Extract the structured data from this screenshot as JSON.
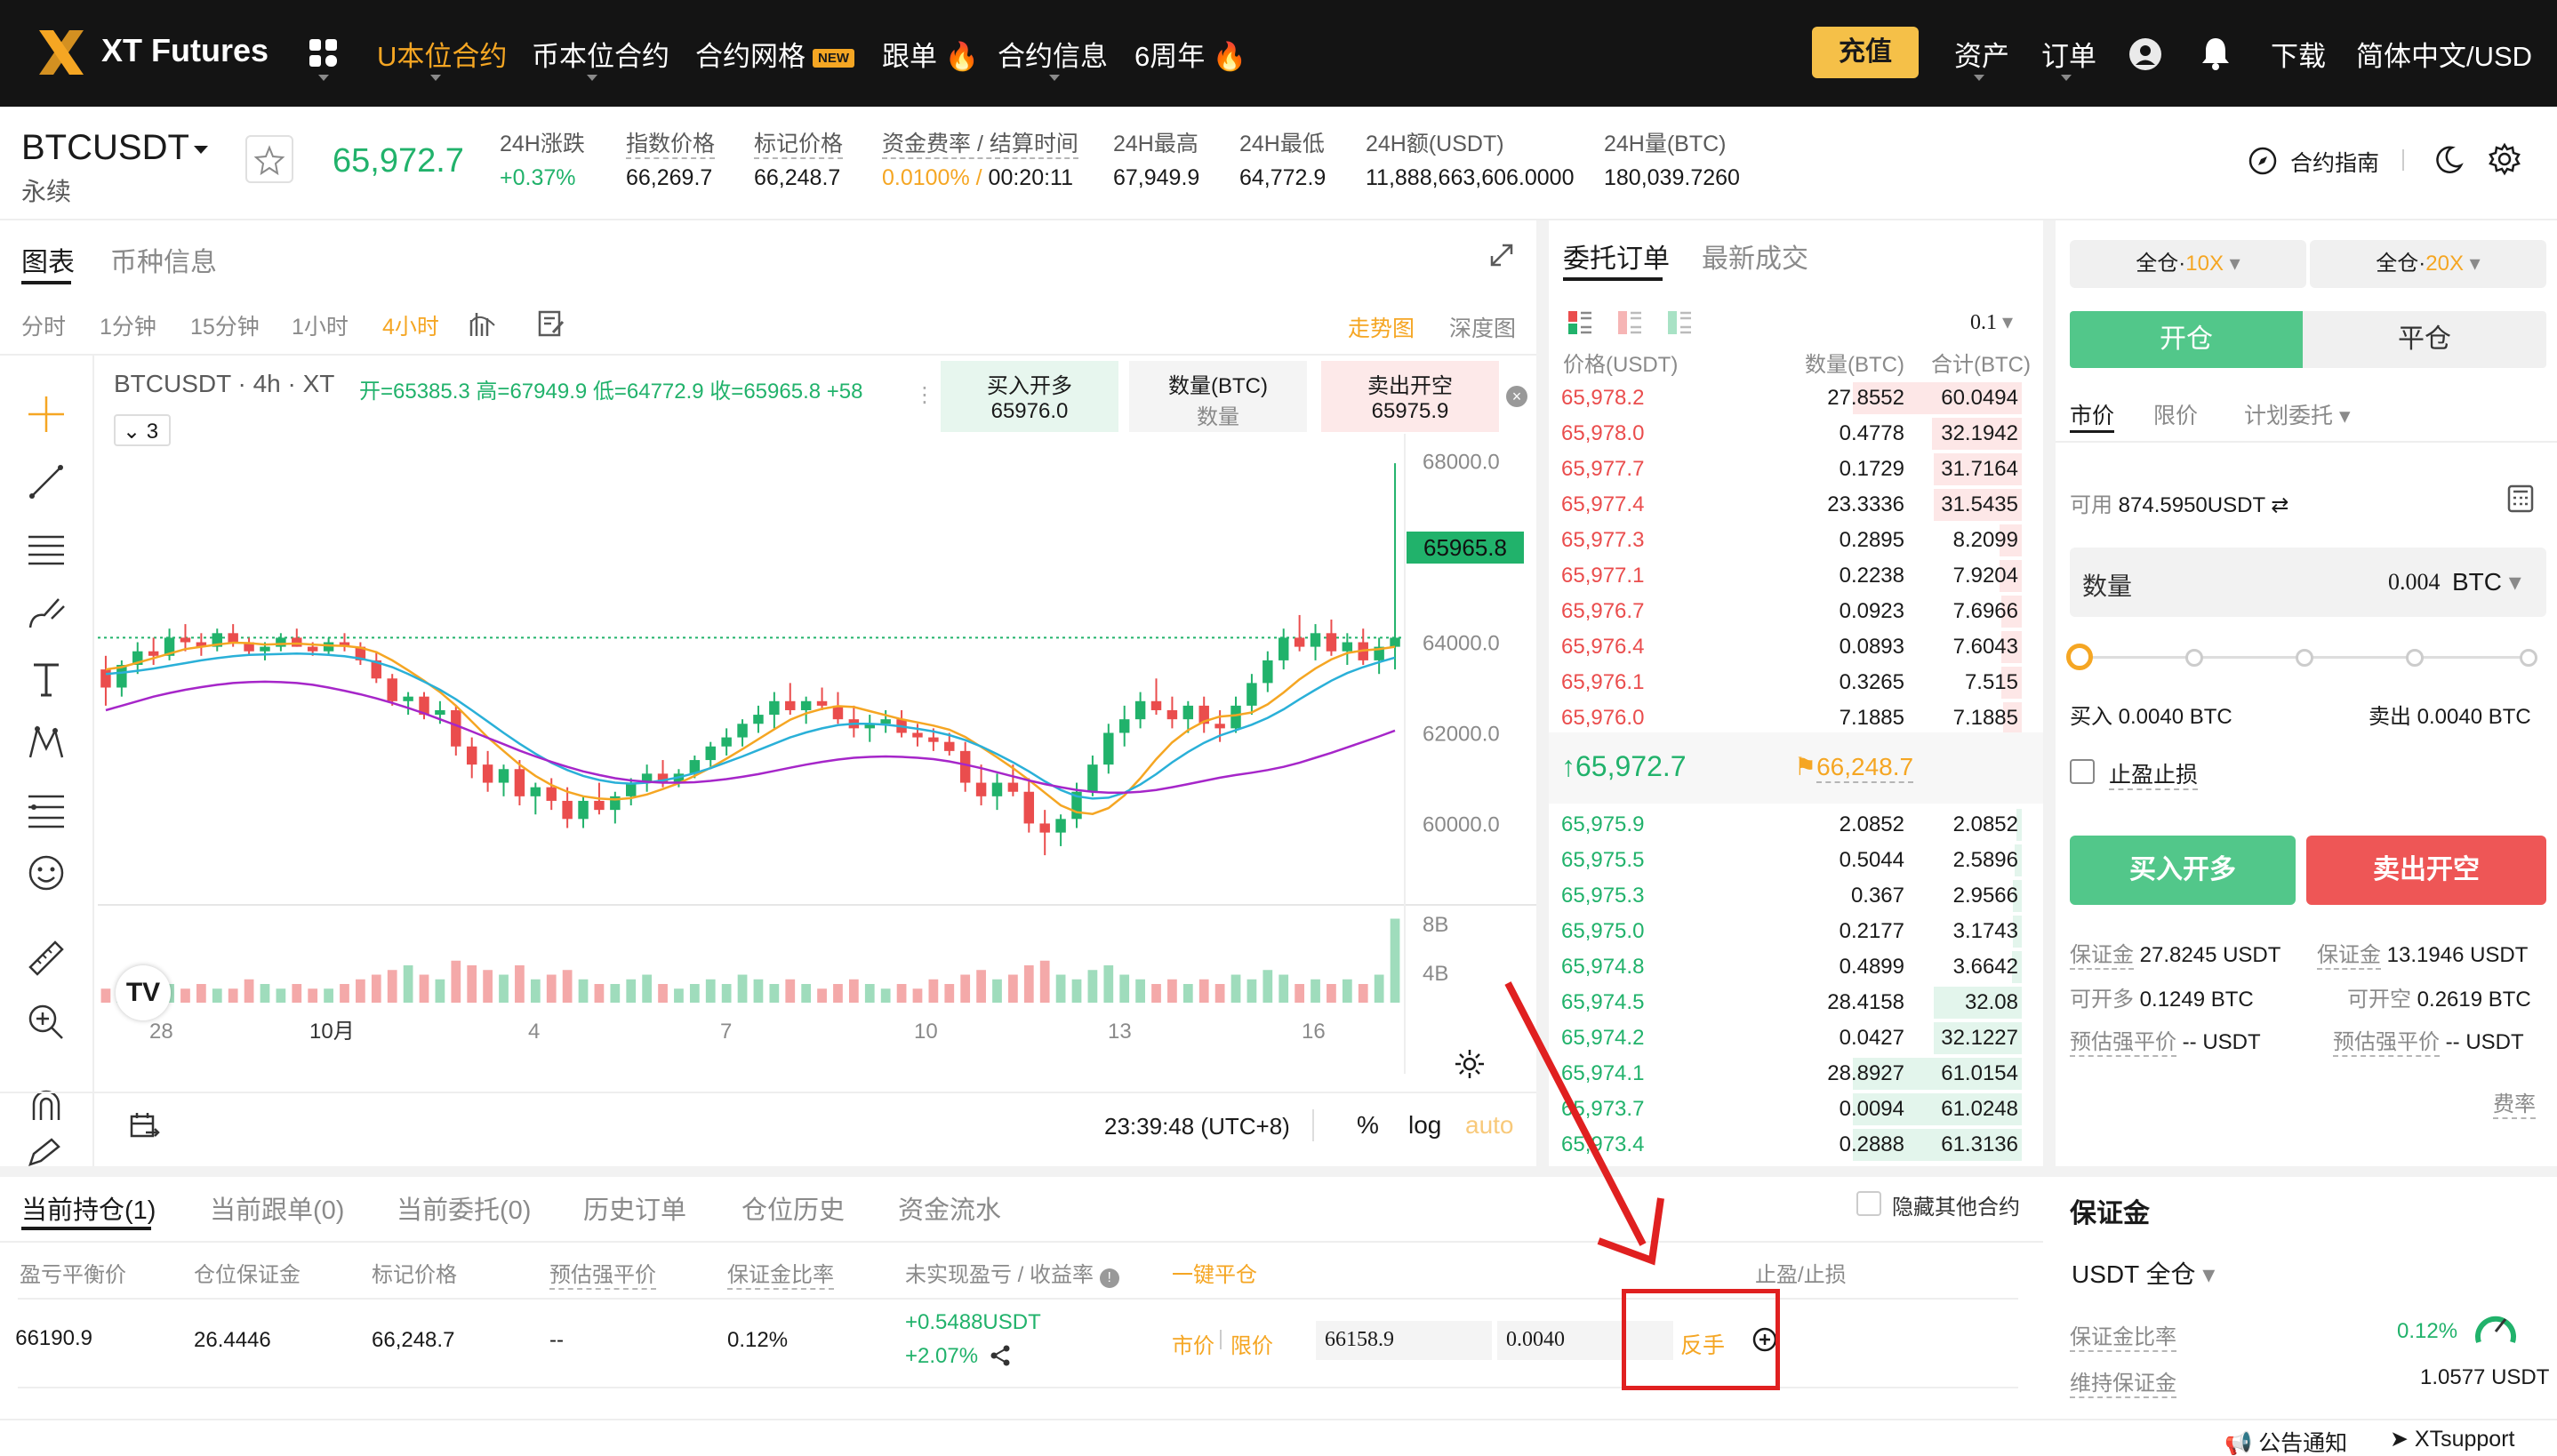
{
  "nav": {
    "logo_text": "XT Futures",
    "items": [
      "U本位合约",
      "币本位合约",
      "合约网格",
      "跟单",
      "合约信息",
      "6周年"
    ],
    "new_badge": "NEW",
    "deposit": "充值",
    "assets": "资产",
    "orders": "订单",
    "download": "下载",
    "locale": "简体中文/USD"
  },
  "ticker": {
    "symbol": "BTCUSDT",
    "subtitle": "永续",
    "last_price": "65,972.7",
    "change_label": "24H涨跌",
    "change_value": "+0.37%",
    "index_label": "指数价格",
    "index_value": "66,269.7",
    "mark_label": "标记价格",
    "mark_value": "66,248.7",
    "funding_label": "资金费率 / 结算时间",
    "funding_rate": "0.0100%",
    "funding_sep": " / ",
    "funding_time": "00:20:11",
    "high_label": "24H最高",
    "high_value": "67,949.9",
    "low_label": "24H最低",
    "low_value": "64,772.9",
    "vol_usdt_label": "24H额(USDT)",
    "vol_usdt_value": "11,888,663,606.0000",
    "vol_btc_label": "24H量(BTC)",
    "vol_btc_value": "180,039.7260",
    "guide": "合约指南"
  },
  "chart_panel": {
    "tabs": [
      "图表",
      "币种信息"
    ],
    "intervals": [
      "分时",
      "1分钟",
      "15分钟",
      "1小时",
      "4小时"
    ],
    "view_trend": "走势图",
    "view_depth": "深度图",
    "legend_symbol": "BTCUSDT · 4h · XT",
    "ohlc": "开=65385.3  高=67949.9  低=64772.9  收=65965.8  +58",
    "indicator_count": "3",
    "buy_label": "买入开多",
    "buy_price": "65976.0",
    "qty_label": "数量(BTC)",
    "qty_sub": "数量",
    "sell_label": "卖出开空",
    "sell_price": "65975.9",
    "last_price_tag": "65965.8",
    "clock": "23:39:48 (UTC+8)",
    "pct": "%",
    "log": "log",
    "auto": "auto"
  },
  "chart_data": {
    "type": "candlestick",
    "x_ticks": [
      "28",
      "10月",
      "4",
      "7",
      "10",
      "13",
      "16"
    ],
    "y_ticks": [
      68000.0,
      64000.0,
      62000.0,
      60000.0
    ],
    "ylim": [
      58400,
      68600
    ],
    "volume_ticks": [
      "8B",
      "4B"
    ],
    "series": [
      {
        "name": "candles",
        "ohlc": [
          [
            63400,
            63700,
            62600,
            63000
          ],
          [
            63000,
            63600,
            62800,
            63500
          ],
          [
            63500,
            64000,
            63300,
            63800
          ],
          [
            63800,
            64100,
            63500,
            63700
          ],
          [
            63700,
            64300,
            63600,
            64100
          ],
          [
            64100,
            64400,
            63800,
            64000
          ],
          [
            64000,
            64200,
            63700,
            63900
          ],
          [
            63900,
            64300,
            63800,
            64200
          ],
          [
            64200,
            64400,
            63900,
            64000
          ],
          [
            64000,
            64100,
            63700,
            63800
          ],
          [
            63800,
            64000,
            63600,
            63900
          ],
          [
            63900,
            64200,
            63800,
            64100
          ],
          [
            64100,
            64300,
            63900,
            63900
          ],
          [
            63900,
            64000,
            63700,
            63800
          ],
          [
            63800,
            64100,
            63700,
            64000
          ],
          [
            64000,
            64200,
            63800,
            63900
          ],
          [
            63900,
            64000,
            63500,
            63600
          ],
          [
            63600,
            63800,
            63100,
            63200
          ],
          [
            63200,
            63300,
            62600,
            62700
          ],
          [
            62700,
            62900,
            62400,
            62800
          ],
          [
            62800,
            62900,
            62300,
            62400
          ],
          [
            62400,
            62700,
            62200,
            62500
          ],
          [
            62500,
            62600,
            61500,
            61700
          ],
          [
            61700,
            61900,
            61000,
            61300
          ],
          [
            61300,
            61600,
            60700,
            60900
          ],
          [
            60900,
            61300,
            60600,
            61200
          ],
          [
            61200,
            61400,
            60400,
            60600
          ],
          [
            60600,
            60900,
            60200,
            60800
          ],
          [
            60800,
            61000,
            60300,
            60500
          ],
          [
            60500,
            60800,
            59900,
            60100
          ],
          [
            60100,
            60600,
            59900,
            60500
          ],
          [
            60500,
            60900,
            60200,
            60300
          ],
          [
            60300,
            60700,
            60000,
            60600
          ],
          [
            60600,
            61000,
            60400,
            60900
          ],
          [
            60900,
            61300,
            60700,
            61100
          ],
          [
            61100,
            61400,
            60800,
            60900
          ],
          [
            60900,
            61200,
            60800,
            61100
          ],
          [
            61100,
            61500,
            61000,
            61400
          ],
          [
            61400,
            61800,
            61200,
            61700
          ],
          [
            61700,
            62100,
            61500,
            61900
          ],
          [
            61900,
            62300,
            61700,
            62200
          ],
          [
            62200,
            62600,
            62000,
            62400
          ],
          [
            62400,
            62900,
            62100,
            62700
          ],
          [
            62700,
            63100,
            62400,
            62500
          ],
          [
            62500,
            62800,
            62200,
            62700
          ],
          [
            62700,
            63000,
            62500,
            62600
          ],
          [
            62600,
            62900,
            62200,
            62300
          ],
          [
            62300,
            62600,
            61900,
            62100
          ],
          [
            62100,
            62400,
            61800,
            62200
          ],
          [
            62200,
            62500,
            62000,
            62300
          ],
          [
            62300,
            62500,
            61900,
            62000
          ],
          [
            62000,
            62200,
            61700,
            61900
          ],
          [
            61900,
            62100,
            61600,
            61800
          ],
          [
            61800,
            62000,
            61500,
            61600
          ],
          [
            61600,
            61800,
            60700,
            60900
          ],
          [
            60900,
            61300,
            60400,
            60600
          ],
          [
            60600,
            61100,
            60300,
            60900
          ],
          [
            60900,
            61300,
            60600,
            60700
          ],
          [
            60700,
            61000,
            59800,
            60000
          ],
          [
            60000,
            60300,
            59300,
            59800
          ],
          [
            59800,
            60200,
            59500,
            60100
          ],
          [
            60100,
            60900,
            59900,
            60700
          ],
          [
            60700,
            61500,
            60600,
            61300
          ],
          [
            61300,
            62200,
            61100,
            62000
          ],
          [
            62000,
            62600,
            61700,
            62300
          ],
          [
            62300,
            62900,
            62100,
            62700
          ],
          [
            62700,
            63200,
            62400,
            62500
          ],
          [
            62500,
            62800,
            62100,
            62300
          ],
          [
            62300,
            62700,
            62000,
            62600
          ],
          [
            62600,
            62800,
            62000,
            62200
          ],
          [
            62200,
            62500,
            61800,
            62100
          ],
          [
            62100,
            62800,
            62000,
            62600
          ],
          [
            62600,
            63300,
            62400,
            63100
          ],
          [
            63100,
            63800,
            62900,
            63600
          ],
          [
            63600,
            64300,
            63400,
            64100
          ],
          [
            64100,
            64600,
            63800,
            63900
          ],
          [
            63900,
            64400,
            63600,
            64200
          ],
          [
            64200,
            64500,
            63700,
            63800
          ],
          [
            63800,
            64200,
            63500,
            64000
          ],
          [
            64000,
            64300,
            63500,
            63600
          ],
          [
            63600,
            64100,
            63300,
            63900
          ],
          [
            63900,
            67950,
            63400,
            64100
          ]
        ]
      },
      {
        "name": "ma_fast",
        "values": [
          63400,
          63450,
          63550,
          63650,
          63750,
          63850,
          63900,
          63950,
          63990,
          63980,
          63950,
          63960,
          63970,
          63950,
          63930,
          63920,
          63880,
          63780,
          63600,
          63380,
          63150,
          62900,
          62600,
          62250,
          61900,
          61600,
          61300,
          61050,
          60850,
          60700,
          60600,
          60550,
          60530,
          60560,
          60640,
          60760,
          60890,
          61050,
          61230,
          61430,
          61640,
          61860,
          62080,
          62290,
          62430,
          62530,
          62590,
          62570,
          62480,
          62390,
          62300,
          62230,
          62160,
          62070,
          61910,
          61690,
          61460,
          61220,
          60960,
          60680,
          60400,
          60250,
          60210,
          60340,
          60620,
          61000,
          61420,
          61790,
          62060,
          62250,
          62360,
          62390,
          62450,
          62630,
          62890,
          63180,
          63420,
          63620,
          63760,
          63820,
          63850,
          63900
        ]
      },
      {
        "name": "ma_mid",
        "values": [
          63300,
          63330,
          63370,
          63420,
          63480,
          63540,
          63600,
          63650,
          63690,
          63720,
          63730,
          63740,
          63750,
          63740,
          63720,
          63690,
          63640,
          63560,
          63450,
          63300,
          63130,
          62950,
          62740,
          62500,
          62250,
          62000,
          61760,
          61540,
          61340,
          61180,
          61050,
          60960,
          60900,
          60880,
          60900,
          60950,
          61020,
          61110,
          61220,
          61350,
          61480,
          61620,
          61760,
          61900,
          62010,
          62100,
          62170,
          62200,
          62200,
          62180,
          62140,
          62090,
          62030,
          61950,
          61840,
          61700,
          61530,
          61350,
          61150,
          60930,
          60740,
          60600,
          60550,
          60570,
          60680,
          60860,
          61090,
          61350,
          61580,
          61780,
          61940,
          62060,
          62180,
          62330,
          62520,
          62740,
          62950,
          63150,
          63320,
          63450,
          63560,
          63660
        ]
      },
      {
        "name": "ma_slow",
        "values": [
          62500,
          62600,
          62700,
          62800,
          62880,
          62950,
          63010,
          63060,
          63100,
          63120,
          63130,
          63120,
          63100,
          63060,
          63000,
          62930,
          62850,
          62760,
          62660,
          62550,
          62430,
          62300,
          62170,
          62030,
          61890,
          61750,
          61610,
          61480,
          61360,
          61250,
          61150,
          61070,
          61000,
          60950,
          60920,
          60900,
          60900,
          60910,
          60940,
          60980,
          61030,
          61090,
          61160,
          61230,
          61300,
          61360,
          61410,
          61450,
          61470,
          61480,
          61470,
          61450,
          61420,
          61370,
          61300,
          61220,
          61130,
          61040,
          60950,
          60870,
          60800,
          60740,
          60700,
          60680,
          60680,
          60700,
          60740,
          60800,
          60870,
          60940,
          61010,
          61070,
          61120,
          61180,
          61250,
          61340,
          61450,
          61560,
          61680,
          61800,
          61920,
          62050
        ]
      },
      {
        "name": "volume",
        "values": [
          3,
          4,
          3,
          5,
          4,
          3,
          4,
          3,
          3,
          5,
          4,
          3,
          4,
          3,
          3,
          4,
          5,
          6,
          7,
          8,
          6,
          5,
          9,
          8,
          7,
          6,
          8,
          5,
          6,
          7,
          5,
          4,
          4,
          5,
          6,
          4,
          3,
          4,
          5,
          4,
          6,
          5,
          4,
          5,
          4,
          3,
          4,
          5,
          4,
          3,
          4,
          3,
          5,
          4,
          6,
          7,
          5,
          6,
          8,
          9,
          6,
          5,
          7,
          8,
          6,
          5,
          4,
          5,
          4,
          5,
          4,
          6,
          5,
          7,
          6,
          4,
          5,
          4,
          5,
          4,
          6,
          18
        ]
      }
    ]
  },
  "orderbook": {
    "tabs": [
      "委托订单",
      "最新成交"
    ],
    "precision": "0.1",
    "headers": [
      "价格(USDT)",
      "数量(BTC)",
      "合计(BTC)"
    ],
    "asks": [
      [
        "65,978.2",
        "27.8552",
        "60.0494",
        1.0
      ],
      [
        "65,978.0",
        "0.4778",
        "32.1942",
        0.53
      ],
      [
        "65,977.7",
        "0.1729",
        "31.7164",
        0.52
      ],
      [
        "65,977.4",
        "23.3336",
        "31.5435",
        0.52
      ],
      [
        "65,977.3",
        "0.2895",
        "8.2099",
        0.13
      ],
      [
        "65,977.1",
        "0.2238",
        "7.9204",
        0.13
      ],
      [
        "65,976.7",
        "0.0923",
        "7.6966",
        0.12
      ],
      [
        "65,976.4",
        "0.0893",
        "7.6043",
        0.12
      ],
      [
        "65,976.1",
        "0.3265",
        "7.515",
        0.12
      ],
      [
        "65,976.0",
        "7.1885",
        "7.1885",
        0.11
      ]
    ],
    "mid_price": "65,972.7",
    "mark_price": "66,248.7",
    "bids": [
      [
        "65,975.9",
        "2.0852",
        "2.0852",
        0.03
      ],
      [
        "65,975.5",
        "0.5044",
        "2.5896",
        0.04
      ],
      [
        "65,975.3",
        "0.367",
        "2.9566",
        0.05
      ],
      [
        "65,975.0",
        "0.2177",
        "3.1743",
        0.05
      ],
      [
        "65,974.8",
        "0.4899",
        "3.6642",
        0.06
      ],
      [
        "65,974.5",
        "28.4158",
        "32.08",
        0.52
      ],
      [
        "65,974.2",
        "0.0427",
        "32.1227",
        0.52
      ],
      [
        "65,974.1",
        "28.8927",
        "61.0154",
        1.0
      ],
      [
        "65,973.7",
        "0.0094",
        "61.0248",
        1.0
      ],
      [
        "65,973.4",
        "0.2888",
        "61.3136",
        1.0
      ]
    ]
  },
  "trade": {
    "margin_mode_1": "全仓",
    "lev_1": "10X",
    "margin_mode_2": "全仓",
    "lev_2": "20X",
    "open": "开仓",
    "close": "平仓",
    "order_types": [
      "市价",
      "限价",
      "计划委托"
    ],
    "available_label": "可用",
    "available_value": "874.5950USDT",
    "qty_label": "数量",
    "qty_value": "0.004",
    "qty_unit": "BTC",
    "slider_pct": 0,
    "buy_est": "买入 0.0040 BTC",
    "sell_est": "卖出 0.0040 BTC",
    "tpsl": "止盈止损",
    "buy_btn": "买入开多",
    "sell_btn": "卖出开空",
    "margin_label": "保证金",
    "buy_margin": "27.8245 USDT",
    "sell_margin": "13.1946 USDT",
    "max_long_label": "可开多",
    "max_long": "0.1249 BTC",
    "max_short_label": "可开空",
    "max_short": "0.2619 BTC",
    "liq_long_label": "预估强平价",
    "liq_long": "-- USDT",
    "liq_short_label": "预估强平价",
    "liq_short": "-- USDT",
    "fee": "费率"
  },
  "margin_panel": {
    "title": "保证金",
    "mode": "USDT 全仓",
    "ratio_label": "保证金比率",
    "ratio_value": "0.12%",
    "maint_label": "维持保证金",
    "maint_value": "1.0577 USDT"
  },
  "positions": {
    "tabs": [
      "当前持仓(1)",
      "当前跟单(0)",
      "当前委托(0)",
      "历史订单",
      "仓位历史",
      "资金流水"
    ],
    "hide_others": "隐藏其他合约",
    "headers": [
      "盈亏平衡价",
      "仓位保证金",
      "标记价格",
      "预估强平价",
      "保证金比率",
      "未实现盈亏 / 收益率",
      "一键平仓",
      "止盈/止损"
    ],
    "row": {
      "breakeven": "66190.9",
      "margin": "26.4446",
      "mark": "66,248.7",
      "liq": "--",
      "ratio": "0.12%",
      "pnl": "+0.5488USDT",
      "roe": "+2.07%",
      "market": "市价",
      "limit": "限价",
      "price_input": "66158.9",
      "qty_input": "0.0040",
      "reverse": "反手"
    }
  },
  "footer": {
    "announce": "公告通知",
    "support": "XTsupport"
  },
  "colors": {
    "up": "#21b26b",
    "down": "#ea4d4d",
    "accent": "#f5a623",
    "annotation": "#e02020"
  }
}
